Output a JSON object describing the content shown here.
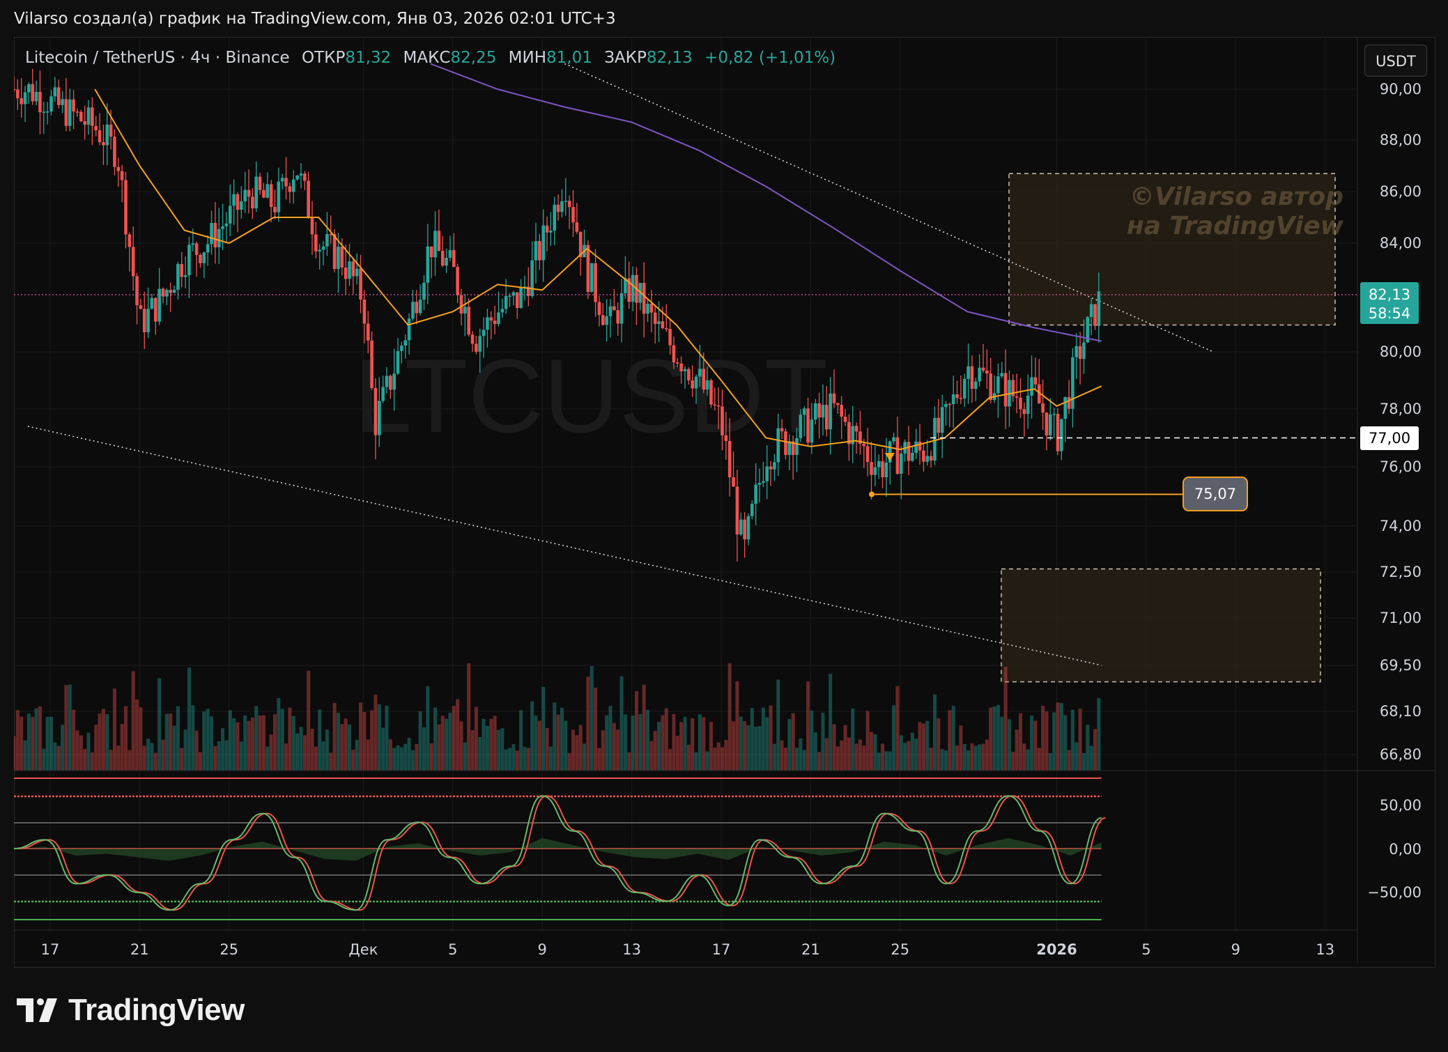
{
  "header": {
    "attribution": "Vilarso создал(а) график на TradingView.com, Янв 03, 2026 02:01 UTC+3"
  },
  "symbol": {
    "description": "Litecoin / TetherUS · 4ч · Binance",
    "open_label": "ОТКР",
    "open_value": "81,32",
    "high_label": "МАКС",
    "high_value": "82,25",
    "low_label": "МИН",
    "low_value": "81,01",
    "close_label": "ЗАКР",
    "close_value": "82,13",
    "change": "+0,82 (+1,01%)"
  },
  "currency_button": "USDT",
  "watermark": {
    "ticker": "LTCUSDT",
    "author_line1": "©Vilarso автор",
    "author_line2": "на TradingView"
  },
  "price_scale": {
    "labels": [
      "90,00",
      "88,00",
      "86,00",
      "84,00",
      "80,00",
      "78,00",
      "76,00",
      "74,00",
      "72,50",
      "71,00",
      "69,50",
      "68,10",
      "66,80"
    ],
    "current_price": "82,13",
    "countdown": "58:54",
    "level_label": "77,00",
    "marker_label": "75,07"
  },
  "oscillator_scale": {
    "labels": [
      "50,00",
      "0,00",
      "−50,00"
    ]
  },
  "time_axis": {
    "labels": [
      "17",
      "21",
      "25",
      "Дек",
      "5",
      "9",
      "13",
      "17",
      "21",
      "25",
      "2026",
      "5",
      "9",
      "13"
    ]
  },
  "footer": {
    "brand": "TradingView"
  },
  "colors": {
    "up": "#26a69a",
    "down": "#ef5350",
    "ma_fast": "#f7a21b",
    "ma_slow": "#7e57c2",
    "current_price_bg": "#26a69a",
    "marker_bg": "#5d606b",
    "zone": "#2a2114"
  },
  "chart_data": {
    "type": "candlestick",
    "timeframe": "4h",
    "price_range": [
      66.4,
      91.2
    ],
    "levels": {
      "current": 82.13,
      "horizontal_dashed": 77.0,
      "marker": 75.07
    },
    "zones": [
      {
        "name": "resistance-zone",
        "price_low": 81.0,
        "price_high": 86.7
      },
      {
        "name": "support-zone",
        "price_low": 69.0,
        "price_high": 72.6
      }
    ],
    "trendlines": [
      {
        "name": "upper-trendline",
        "points": [
          [
            "Dec 10",
            91.0
          ],
          [
            "Jan 8",
            80.0
          ]
        ]
      },
      {
        "name": "lower-trendline",
        "points": [
          [
            "Nov 16",
            77.4
          ],
          [
            "Jan 3",
            69.5
          ]
        ]
      }
    ],
    "close_path": [
      [
        "Nov 16",
        90.0
      ],
      [
        "Nov 18",
        89.0
      ],
      [
        "Nov 19",
        88.5
      ],
      [
        "Nov 20",
        87.5
      ],
      [
        "Nov 21",
        81.0
      ],
      [
        "Nov 22",
        82.0
      ],
      [
        "Nov 23",
        83.5
      ],
      [
        "Nov 24",
        84.0
      ],
      [
        "Nov 25",
        85.0
      ],
      [
        "Nov 26",
        86.0
      ],
      [
        "Nov 27",
        85.5
      ],
      [
        "Nov 28",
        87.0
      ],
      [
        "Nov 29",
        84.0
      ],
      [
        "Nov 30",
        83.5
      ],
      [
        "Dec 1",
        82.0
      ],
      [
        "Dec 1 12:00",
        77.5
      ],
      [
        "Dec 2",
        78.5
      ],
      [
        "Dec 3",
        81.0
      ],
      [
        "Dec 4",
        84.0
      ],
      [
        "Dec 5",
        83.0
      ],
      [
        "Dec 6",
        80.5
      ],
      [
        "Dec 7",
        81.5
      ],
      [
        "Dec 8",
        82.0
      ],
      [
        "Dec 9",
        84.0
      ],
      [
        "Dec 10",
        86.5
      ],
      [
        "Dec 11",
        83.0
      ],
      [
        "Dec 12",
        81.0
      ],
      [
        "Dec 13",
        82.5
      ],
      [
        "Dec 14",
        81.0
      ],
      [
        "Dec 15",
        80.0
      ],
      [
        "Dec 16",
        79.0
      ],
      [
        "Dec 17",
        77.5
      ],
      [
        "Dec 18",
        73.0
      ],
      [
        "Dec 19",
        76.5
      ],
      [
        "Dec 20",
        77.0
      ],
      [
        "Dec 21",
        77.5
      ],
      [
        "Dec 22",
        78.0
      ],
      [
        "Dec 23",
        77.0
      ],
      [
        "Dec 24",
        76.0
      ],
      [
        "Dec 25",
        76.5
      ],
      [
        "Dec 26",
        76.5
      ],
      [
        "Dec 27",
        77.5
      ],
      [
        "Dec 28",
        79.5
      ],
      [
        "Dec 29",
        79.0
      ],
      [
        "Dec 30",
        78.5
      ],
      [
        "Dec 31",
        78.5
      ],
      [
        "Jan 1",
        77.0
      ],
      [
        "Jan 2",
        80.0
      ],
      [
        "Jan 3",
        82.13
      ]
    ],
    "ma_fast": [
      [
        "Nov 19",
        90.0
      ],
      [
        "Nov 21",
        87.0
      ],
      [
        "Nov 23",
        84.5
      ],
      [
        "Nov 25",
        84.0
      ],
      [
        "Nov 27",
        85.0
      ],
      [
        "Nov 29",
        85.0
      ],
      [
        "Dec 1",
        83.0
      ],
      [
        "Dec 3",
        81.0
      ],
      [
        "Dec 5",
        81.5
      ],
      [
        "Dec 7",
        82.5
      ],
      [
        "Dec 9",
        82.3
      ],
      [
        "Dec 11",
        83.8
      ],
      [
        "Dec 13",
        82.5
      ],
      [
        "Dec 15",
        81.0
      ],
      [
        "Dec 17",
        79.0
      ],
      [
        "Dec 19",
        77.0
      ],
      [
        "Dec 21",
        76.7
      ],
      [
        "Dec 23",
        76.9
      ],
      [
        "Dec 25",
        76.6
      ],
      [
        "Dec 27",
        77.0
      ],
      [
        "Dec 29",
        78.4
      ],
      [
        "Dec 31",
        78.7
      ],
      [
        "Jan 1",
        78.1
      ],
      [
        "Jan 3",
        78.8
      ]
    ],
    "ma_slow": [
      [
        "Dec 4",
        91.0
      ],
      [
        "Dec 7",
        90.0
      ],
      [
        "Dec 10",
        89.3
      ],
      [
        "Dec 13",
        88.7
      ],
      [
        "Dec 16",
        87.6
      ],
      [
        "Dec 19",
        86.2
      ],
      [
        "Dec 22",
        84.6
      ],
      [
        "Dec 25",
        83.0
      ],
      [
        "Dec 28",
        81.5
      ],
      [
        "Dec 31",
        80.9
      ],
      [
        "Jan 3",
        80.4
      ]
    ],
    "oscillator": {
      "range": [
        -70,
        70
      ],
      "levels": [
        -60,
        50,
        0
      ],
      "series": [
        {
          "values": [
            0,
            10,
            -40,
            -30,
            -50,
            -70,
            -40,
            10,
            40,
            -10,
            -60,
            -70,
            10,
            30,
            -10,
            -40,
            -20,
            60,
            20,
            -20,
            -50,
            -60,
            -30,
            -65,
            10,
            -10,
            -40,
            -20,
            40,
            20,
            -40,
            20,
            60,
            20,
            -40,
            35
          ]
        }
      ]
    }
  }
}
